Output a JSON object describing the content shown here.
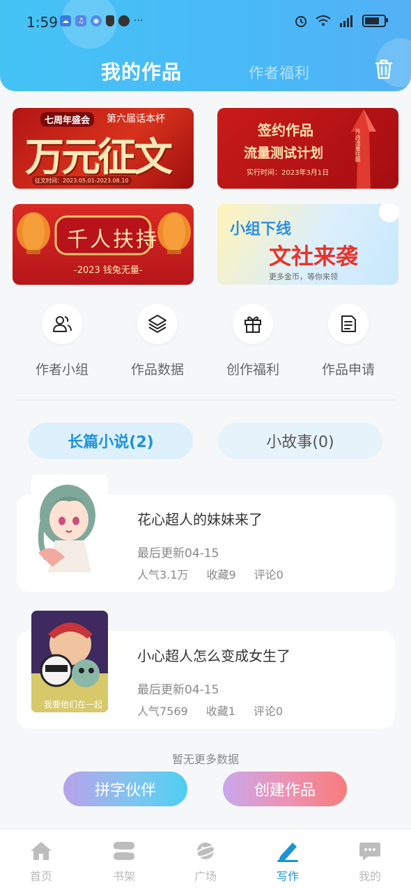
{
  "status_bar": {
    "time": "1:59",
    "more": "···"
  },
  "header": {
    "tab_active": "我的作品",
    "tab_inactive": "作者福利"
  },
  "banners": {
    "b1": {
      "badge": "七周年盛会",
      "subtitle": "第六届话本杯",
      "title": "万元征文",
      "date": "征文时间：2023.05.01-2023.08.10"
    },
    "b2": {
      "line1": "签约作品",
      "line2": "流量测试计划",
      "line3": "实行时间：2023年3月1日",
      "side": "开启流量狂飙"
    },
    "b3": {
      "title": "千人扶持",
      "subtitle": "-2023 钱兔无量-"
    },
    "b4": {
      "line1": "小组下线",
      "line2": "文社来袭",
      "line3": "更多金币，等你来领"
    }
  },
  "features": [
    {
      "label": "作者小组",
      "icon": "users-icon"
    },
    {
      "label": "作品数据",
      "icon": "layers-icon"
    },
    {
      "label": "创作福利",
      "icon": "gift-icon"
    },
    {
      "label": "作品申请",
      "icon": "document-icon"
    }
  ],
  "tabs": {
    "long": "长篇小说(2)",
    "short": "小故事(0)"
  },
  "works": [
    {
      "title": "花心超人的妹妹来了",
      "updated": "最后更新04-15",
      "popularity": "人气3.1万",
      "favorites": "收藏9",
      "comments": "评论0"
    },
    {
      "title": "小心超人怎么变成女生了",
      "updated": "最后更新04-15",
      "popularity": "人气7569",
      "favorites": "收藏1",
      "comments": "评论0",
      "cover_caption": "我要他们在一起"
    }
  ],
  "no_more": "暂无更多数据",
  "buttons": {
    "partner": "拼字伙伴",
    "create": "创建作品"
  },
  "nav": [
    {
      "label": "首页",
      "icon": "home-icon"
    },
    {
      "label": "书架",
      "icon": "bookshelf-icon"
    },
    {
      "label": "广场",
      "icon": "planet-icon"
    },
    {
      "label": "写作",
      "icon": "pen-icon",
      "active": true
    },
    {
      "label": "我的",
      "icon": "chat-icon"
    }
  ],
  "colors": {
    "accent": "#1e93d6",
    "header": "#49b9f7",
    "nav_inactive": "#b9b9b9"
  }
}
